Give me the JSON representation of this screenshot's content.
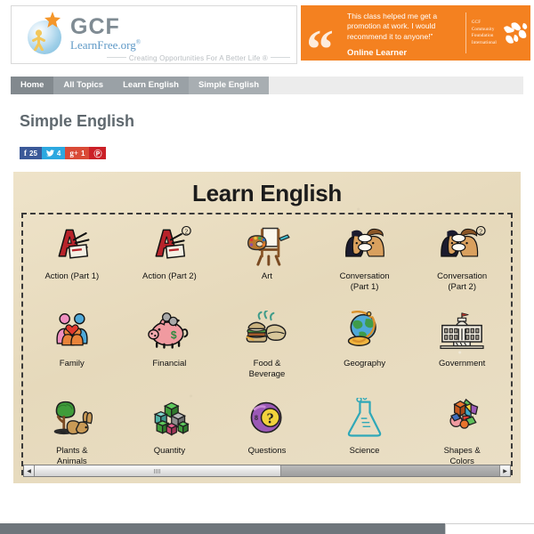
{
  "site": {
    "logo_title": "GCF",
    "logo_subtitle": "LearnFree.org",
    "logo_registered": "®",
    "tagline": "Creating Opportunities For A Better Life ®"
  },
  "banner": {
    "quote": "This class helped me get a promotion at work. I would recommend it to anyone!”",
    "attribution": "Online Learner",
    "org_line1": "GCF",
    "org_line2": "Community",
    "org_line3": "Foundation",
    "org_line4": "International",
    "background_color": "#f48120"
  },
  "nav": {
    "items": [
      {
        "label": "Home",
        "state": "home"
      },
      {
        "label": "All Topics",
        "state": "normal"
      },
      {
        "label": "Learn English",
        "state": "normal"
      },
      {
        "label": "Simple English",
        "state": "active"
      }
    ]
  },
  "page": {
    "title": "Simple English"
  },
  "social": [
    {
      "network": "facebook",
      "glyph": "f",
      "count": "25",
      "color": "#3b5998"
    },
    {
      "network": "twitter",
      "glyph": "ᴠ",
      "count": "4",
      "color": "#2ca8e0"
    },
    {
      "network": "googleplus",
      "glyph": "g+",
      "count": "1",
      "color": "#d94a36"
    },
    {
      "network": "pinterest",
      "glyph": "Ⓟ",
      "count": "",
      "color": "#cb2027"
    }
  ],
  "content": {
    "heading": "Learn English",
    "tiles": [
      {
        "label": "Action (Part 1)",
        "icon": "action-part1-icon"
      },
      {
        "label": "Action (Part 2)",
        "icon": "action-part2-icon"
      },
      {
        "label": "Art",
        "icon": "art-easel-icon"
      },
      {
        "label": "Conversation\n(Part 1)",
        "icon": "conversation-part1-icon"
      },
      {
        "label": "Conversation\n(Part 2)",
        "icon": "conversation-part2-icon"
      },
      {
        "label": "Family",
        "icon": "family-icon"
      },
      {
        "label": "Financial",
        "icon": "piggy-bank-icon"
      },
      {
        "label": "Food &\nBeverage",
        "icon": "food-beverage-icon"
      },
      {
        "label": "Geography",
        "icon": "globe-icon"
      },
      {
        "label": "Government",
        "icon": "government-building-icon"
      },
      {
        "label": "Plants &\nAnimals",
        "icon": "plants-animals-icon"
      },
      {
        "label": "Quantity",
        "icon": "quantity-blocks-icon"
      },
      {
        "label": "Questions",
        "icon": "question-ball-icon"
      },
      {
        "label": "Science",
        "icon": "science-flask-icon"
      },
      {
        "label": "Shapes &\nColors",
        "icon": "shapes-colors-icon"
      }
    ]
  },
  "scrollbar": {
    "left_arrow": "◀",
    "right_arrow": "▶",
    "thumb_position_percent": 0,
    "thumb_width_percent": 53
  }
}
